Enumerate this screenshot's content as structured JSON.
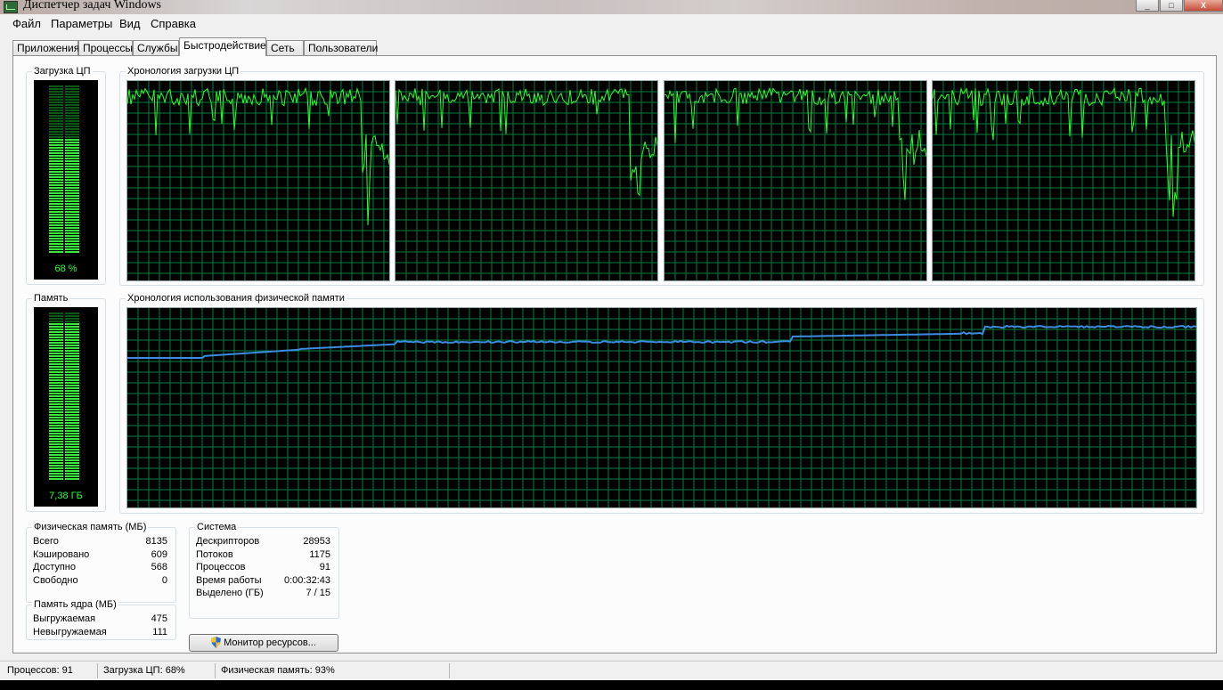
{
  "window": {
    "title": "Диспетчер задач Windows",
    "buttons": {
      "minimize": "_",
      "maximize": "□",
      "close": "X"
    }
  },
  "menu": [
    "Файл",
    "Параметры",
    "Вид",
    "Справка"
  ],
  "tabs": [
    "Приложения",
    "Процессы",
    "Службы",
    "Быстродействие",
    "Сеть",
    "Пользователи"
  ],
  "active_tab": "Быстродействие",
  "cpu": {
    "usage_title": "Загрузка ЦП",
    "usage_value": "68 %",
    "usage_fraction": 0.68,
    "history_title": "Хронология загрузки ЦП",
    "core_count": 4
  },
  "memory": {
    "usage_title": "Память",
    "usage_value": "7,38 ГБ",
    "usage_fraction": 0.93,
    "history_title": "Хронология использования физической памяти"
  },
  "physical_memory": {
    "title": "Физическая память (МБ)",
    "rows": [
      {
        "label": "Всего",
        "value": "8135"
      },
      {
        "label": "Кэшировано",
        "value": "609"
      },
      {
        "label": "Доступно",
        "value": "568"
      },
      {
        "label": "Свободно",
        "value": "0"
      }
    ]
  },
  "kernel_memory": {
    "title": "Память ядра (МБ)",
    "rows": [
      {
        "label": "Выгружаемая",
        "value": "475"
      },
      {
        "label": "Невыгружаемая",
        "value": "111"
      }
    ]
  },
  "system": {
    "title": "Система",
    "rows": [
      {
        "label": "Дескрипторов",
        "value": "28953"
      },
      {
        "label": "Потоков",
        "value": "1175"
      },
      {
        "label": "Процессов",
        "value": "91"
      },
      {
        "label": "Время работы",
        "value": "0:00:32:43"
      },
      {
        "label": "Выделено (ГБ)",
        "value": "7 / 15"
      }
    ]
  },
  "resource_monitor_button": "Монитор ресурсов...",
  "statusbar": {
    "processes": "Процессов: 91",
    "cpu": "Загрузка ЦП: 68%",
    "memory": "Физическая память: 93%"
  },
  "colors": {
    "graph_bg": "#000000",
    "grid": "#008040",
    "cpu_line": "#2bff2b",
    "mem_line": "#3c8de0"
  }
}
